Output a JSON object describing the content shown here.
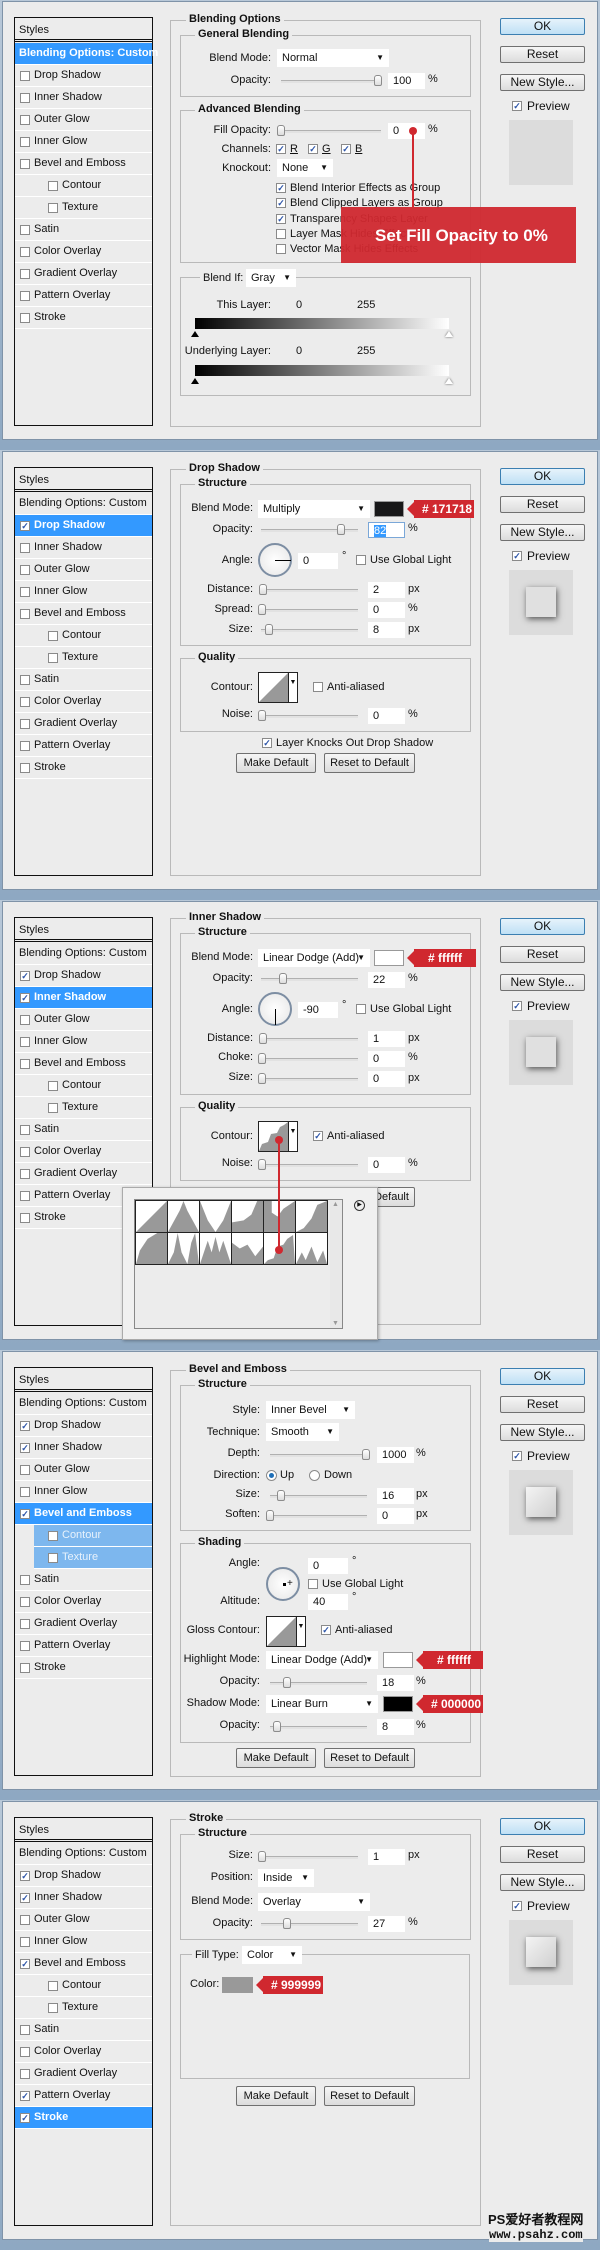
{
  "dialog_buttons": {
    "ok": "OK",
    "reset": "Reset",
    "new_style": "New Style...",
    "preview": "Preview",
    "make_default": "Make Default",
    "reset_to_default": "Reset to Default"
  },
  "styles_header": "Styles",
  "style_items": [
    "Blending Options: Custom",
    "Drop Shadow",
    "Inner Shadow",
    "Outer Glow",
    "Inner Glow",
    "Bevel and Emboss",
    "Contour",
    "Texture",
    "Satin",
    "Color Overlay",
    "Gradient Overlay",
    "Pattern Overlay",
    "Stroke"
  ],
  "panels": [
    {
      "checked": [
        false,
        false,
        false,
        false,
        false,
        false,
        false,
        false,
        false,
        false,
        false,
        false,
        false
      ],
      "selected": 0,
      "subselected": [],
      "title": "Blending Options",
      "general": {
        "title": "General Blending",
        "blend_mode_label": "Blend Mode:",
        "blend_mode": "Normal",
        "opacity_label": "Opacity:",
        "opacity": "100",
        "unit": "%"
      },
      "advanced": {
        "title": "Advanced Blending",
        "fill_opacity_label": "Fill Opacity:",
        "fill_opacity": "0",
        "unit": "%",
        "channels_label": "Channels:",
        "channels": [
          {
            "label": "R",
            "checked": true
          },
          {
            "label": "G",
            "checked": true
          },
          {
            "label": "B",
            "checked": true
          }
        ],
        "knockout_label": "Knockout:",
        "knockout": "None",
        "options": [
          {
            "label": "Blend Interior Effects as Group",
            "checked": true
          },
          {
            "label": "Blend Clipped Layers as Group",
            "checked": true
          },
          {
            "label": "Transparency Shapes Layer",
            "checked": true
          },
          {
            "label": "Layer Mask Hides Effects",
            "checked": false
          },
          {
            "label": "Vector Mask Hides Effects",
            "checked": false
          }
        ]
      },
      "annotation": "Set Fill Opacity to 0%",
      "blend_if": {
        "label": "Blend If:",
        "value": "Gray",
        "this_layer": "This Layer:",
        "underlying": "Underlying Layer:",
        "min": "0",
        "max": "255"
      }
    },
    {
      "checked": [
        false,
        true,
        false,
        false,
        false,
        false,
        false,
        false,
        false,
        false,
        false,
        false,
        false
      ],
      "selected": 1,
      "subselected": [],
      "title": "Drop Shadow",
      "structure_title": "Structure",
      "blend_mode_label": "Blend Mode:",
      "blend_mode": "Multiply",
      "color": "#171718",
      "color_tag": "# 171718",
      "opacity_label": "Opacity:",
      "opacity": "82",
      "angle_label": "Angle:",
      "angle": "0",
      "degree": "°",
      "global_light": "Use Global Light",
      "global_light_checked": false,
      "distance_label": "Distance:",
      "distance": "2",
      "spread_label": "Spread:",
      "spread": "0",
      "size_label": "Size:",
      "size": "8",
      "quality_title": "Quality",
      "contour_label": "Contour:",
      "anti_aliased": "Anti-aliased",
      "anti_aliased_checked": false,
      "noise_label": "Noise:",
      "noise": "0",
      "knocks_out": "Layer Knocks Out Drop Shadow",
      "knocks_out_checked": true,
      "pct": "%",
      "px": "px"
    },
    {
      "checked": [
        false,
        true,
        true,
        false,
        false,
        false,
        false,
        false,
        false,
        false,
        false,
        false,
        false
      ],
      "selected": 2,
      "subselected": [],
      "title": "Inner Shadow",
      "structure_title": "Structure",
      "blend_mode_label": "Blend Mode:",
      "blend_mode": "Linear Dodge (Add)",
      "color": "#ffffff",
      "color_tag": "# ffffff",
      "opacity_label": "Opacity:",
      "opacity": "22",
      "angle_label": "Angle:",
      "angle": "-90",
      "degree": "°",
      "global_light": "Use Global Light",
      "global_light_checked": false,
      "distance_label": "Distance:",
      "distance": "1",
      "choke_label": "Choke:",
      "choke": "0",
      "size_label": "Size:",
      "size": "0",
      "quality_title": "Quality",
      "contour_label": "Contour:",
      "anti_aliased": "Anti-aliased",
      "anti_aliased_checked": true,
      "noise_label": "Noise:",
      "noise": "0",
      "pct": "%",
      "px": "px",
      "contour_presets_count": 12
    },
    {
      "checked": [
        false,
        true,
        true,
        false,
        false,
        true,
        false,
        false,
        false,
        false,
        false,
        false,
        false
      ],
      "selected": 5,
      "subselected": [
        6,
        7
      ],
      "title": "Bevel and Emboss",
      "structure_title": "Structure",
      "style_label": "Style:",
      "style": "Inner Bevel",
      "technique_label": "Technique:",
      "technique": "Smooth",
      "depth_label": "Depth:",
      "depth": "1000",
      "direction_label": "Direction:",
      "direction_up": "Up",
      "direction_down": "Down",
      "direction": "Up",
      "size_label": "Size:",
      "size": "16",
      "soften_label": "Soften:",
      "soften": "0",
      "shading_title": "Shading",
      "angle_label": "Angle:",
      "angle": "0",
      "altitude_label": "Altitude:",
      "altitude": "40",
      "degree": "°",
      "global_light": "Use Global Light",
      "global_light_checked": false,
      "gloss_contour_label": "Gloss Contour:",
      "anti_aliased": "Anti-aliased",
      "anti_aliased_checked": true,
      "highlight_mode_label": "Highlight Mode:",
      "highlight_mode": "Linear Dodge (Add)",
      "highlight_color": "#ffffff",
      "highlight_tag": "# ffffff",
      "highlight_opacity": "18",
      "shadow_mode_label": "Shadow Mode:",
      "shadow_mode": "Linear Burn",
      "shadow_color": "#000000",
      "shadow_tag": "# 000000",
      "shadow_opacity": "8",
      "opacity_label": "Opacity:",
      "pct": "%",
      "px": "px"
    },
    {
      "checked": [
        false,
        true,
        true,
        false,
        false,
        true,
        false,
        false,
        false,
        false,
        false,
        true,
        true
      ],
      "selected": 12,
      "subselected": [],
      "title": "Stroke",
      "structure_title": "Structure",
      "size_label": "Size:",
      "size": "1",
      "position_label": "Position:",
      "position": "Inside",
      "blend_mode_label": "Blend Mode:",
      "blend_mode": "Overlay",
      "opacity_label": "Opacity:",
      "opacity": "27",
      "fill_type_label": "Fill Type:",
      "fill_type": "Color",
      "color_label": "Color:",
      "color": "#999999",
      "color_tag": "# 999999",
      "pct": "%",
      "px": "px"
    }
  ],
  "watermark": {
    "line1": "PS爱好者教程网",
    "line2": "www.psahz.com"
  },
  "colors": {
    "selection": "#3399ff",
    "annotation": "#d0282f",
    "dialog_bg": "#ececec"
  }
}
